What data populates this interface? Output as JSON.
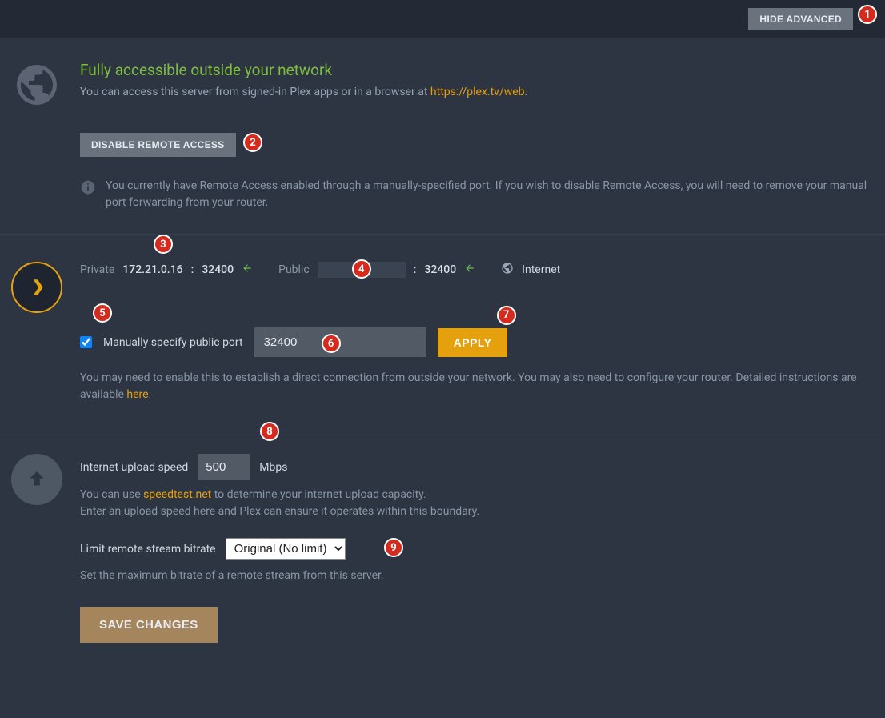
{
  "top": {
    "hide_advanced": "HIDE ADVANCED"
  },
  "access": {
    "title": "Fully accessible outside your network",
    "desc_prefix": "You can access this server from signed-in Plex apps or in a browser at ",
    "desc_link": "https://plex.tv/web",
    "desc_suffix": ".",
    "disable_btn": "DISABLE REMOTE ACCESS",
    "info_text": "You currently have Remote Access enabled through a manually-specified port. If you wish to disable Remote Access, you will need to remove your manual port forwarding from your router."
  },
  "conn": {
    "private_label": "Private",
    "private_ip": "172.21.0.16",
    "private_port": "32400",
    "public_label": "Public",
    "public_port": "32400",
    "internet_label": "Internet",
    "colon": ":"
  },
  "port": {
    "checkbox_label": "Manually specify public port",
    "value": "32400",
    "apply": "APPLY",
    "hint_prefix": "You may need to enable this to establish a direct connection from outside your network. You may also need to configure your router. Detailed instructions are available ",
    "hint_link": "here",
    "hint_suffix": "."
  },
  "upload": {
    "label": "Internet upload speed",
    "value": "500",
    "unit": "Mbps",
    "hint_prefix": "You can use ",
    "hint_link": "speedtest.net",
    "hint_suffix": " to determine your internet upload capacity.",
    "hint_line2": "Enter an upload speed here and Plex can ensure it operates within this boundary."
  },
  "bitrate": {
    "label": "Limit remote stream bitrate",
    "selected": "Original (No limit)",
    "hint": "Set the maximum bitrate of a remote stream from this server."
  },
  "save": {
    "label": "SAVE CHANGES"
  },
  "badges": [
    "1",
    "2",
    "3",
    "4",
    "5",
    "6",
    "7",
    "8",
    "9"
  ]
}
